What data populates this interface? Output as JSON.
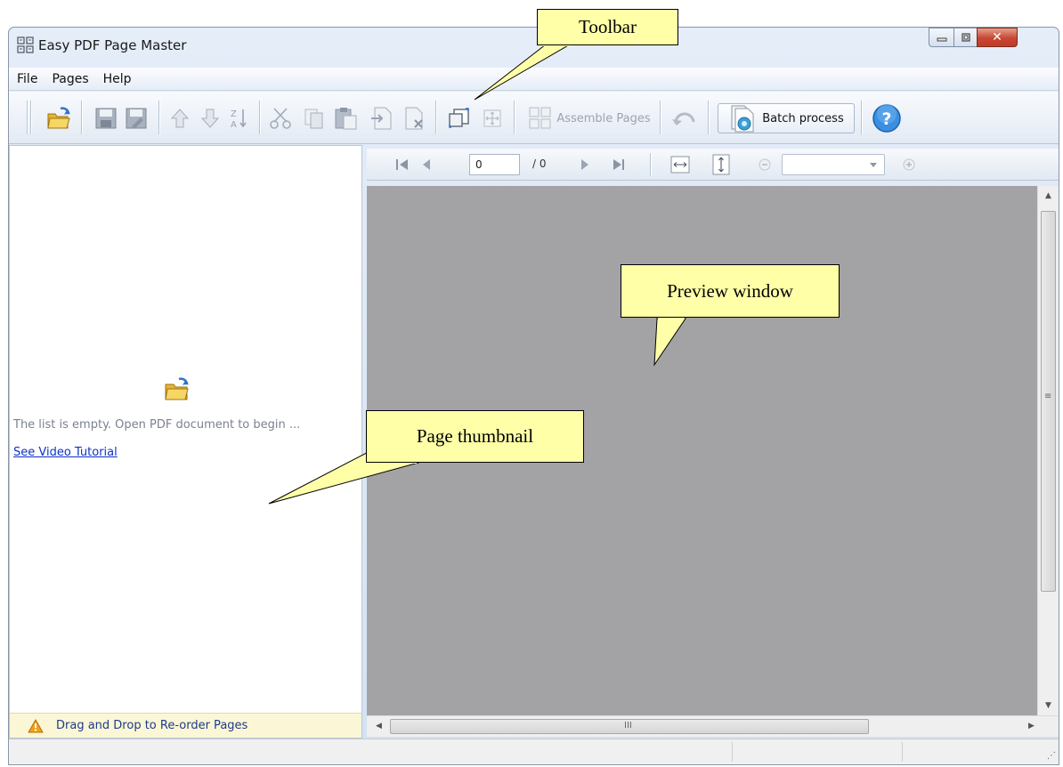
{
  "window": {
    "title": "Easy PDF Page Master"
  },
  "menu": {
    "items": [
      "File",
      "Pages",
      "Help"
    ]
  },
  "toolbar": {
    "buttons": [
      {
        "name": "open-button",
        "icon": "open-folder-icon"
      },
      {
        "name": "save-button",
        "icon": "save-icon"
      },
      {
        "name": "save-as-button",
        "icon": "save-as-icon"
      },
      {
        "name": "move-up-button",
        "icon": "arrow-up-icon"
      },
      {
        "name": "move-down-button",
        "icon": "arrow-down-icon"
      },
      {
        "name": "sort-button",
        "icon": "sort-za-icon"
      },
      {
        "name": "cut-button",
        "icon": "scissors-icon"
      },
      {
        "name": "copy-button",
        "icon": "copy-icon"
      },
      {
        "name": "paste-button",
        "icon": "paste-icon"
      },
      {
        "name": "insert-page-button",
        "icon": "insert-page-icon"
      },
      {
        "name": "delete-page-button",
        "icon": "delete-page-icon"
      },
      {
        "name": "rotate-button",
        "icon": "rotate-icon"
      },
      {
        "name": "fit-button",
        "icon": "fit-page-icon"
      },
      {
        "name": "undo-button",
        "icon": "undo-icon"
      },
      {
        "name": "help-button",
        "icon": "help-icon"
      }
    ],
    "assemble_label": "Assemble Pages",
    "batch_label": "Batch process"
  },
  "thumbnail_panel": {
    "empty_message": "The list is empty. Open  PDF document to begin ...",
    "tutorial_link": "See Video Tutorial",
    "hint": "Drag and Drop to Re-order Pages"
  },
  "navigation": {
    "current_page": "0",
    "total_pages": "/ 0",
    "zoom_value": ""
  },
  "scrollbar": {
    "h_grip": "III",
    "v_grip": "≡"
  },
  "callouts": {
    "toolbar": "Toolbar",
    "preview": "Preview window",
    "thumbnail": "Page thumbnail"
  },
  "colors": {
    "preview_bg": "#a3a3a6",
    "callout_bg": "#ffffa8",
    "link": "#0a32c8",
    "hint_bg": "#fbf7d6",
    "close_button": "#c74633"
  }
}
